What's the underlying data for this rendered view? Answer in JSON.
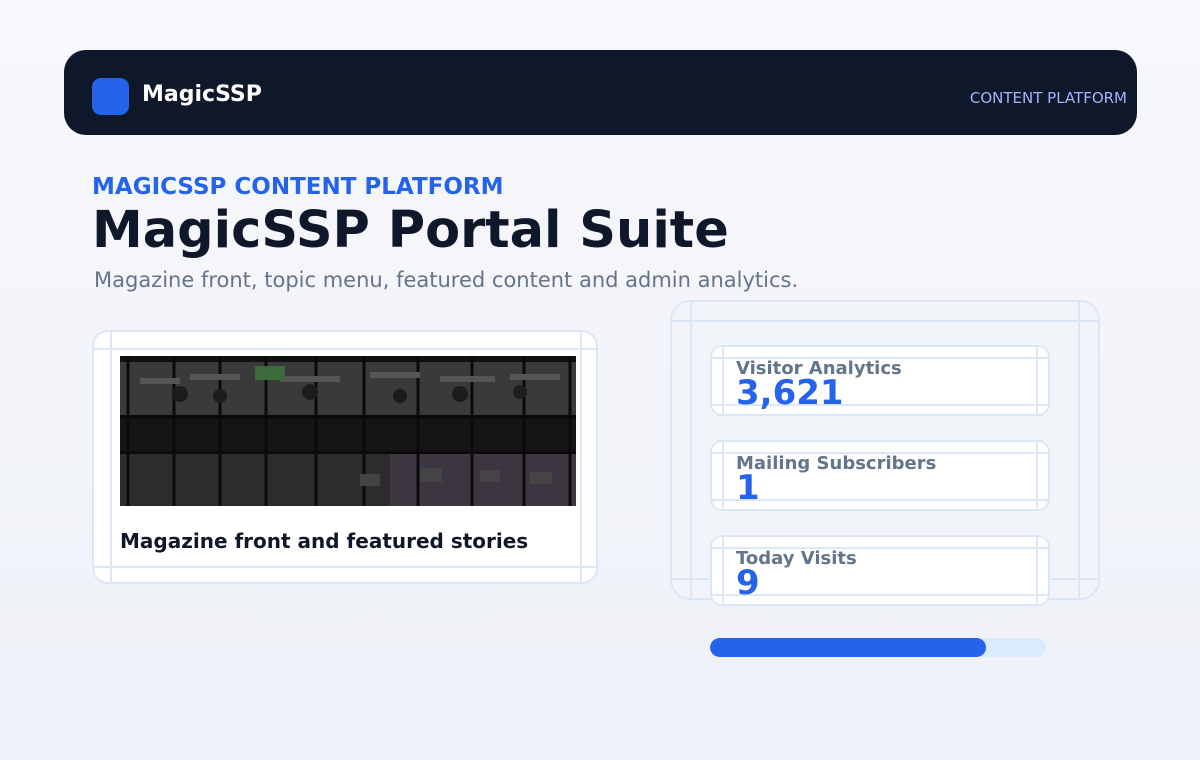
{
  "header": {
    "brand": "MagicSSP",
    "nav_tag": "CONTENT PLATFORM",
    "logo_color": "#2563eb"
  },
  "hero": {
    "eyebrow": "MAGICSSP CONTENT PLATFORM",
    "title": "MagicSSP Portal Suite",
    "subtitle": "Magazine front, topic menu, featured content and admin analytics."
  },
  "feature": {
    "caption": "Magazine front and featured stories",
    "image_icon": "office-photo"
  },
  "stats": [
    {
      "label": "Visitor Analytics",
      "value": "3,621"
    },
    {
      "label": "Mailing Subscribers",
      "value": "1"
    },
    {
      "label": "Today Visits",
      "value": "9"
    }
  ],
  "progress": {
    "percent": 82,
    "color": "#2563eb"
  },
  "colors": {
    "accent": "#2563eb",
    "dark": "#0f172a",
    "muted": "#64748b"
  }
}
